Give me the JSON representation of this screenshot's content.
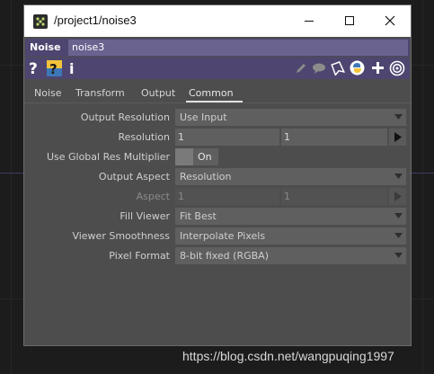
{
  "window": {
    "title": "/project1/noise3"
  },
  "operator": {
    "type_label": "Noise",
    "name": "noise3"
  },
  "iconbar": {
    "left_icons": [
      "help-icon",
      "python-help-icon",
      "info-icon"
    ],
    "right_icons": [
      "pencil-icon",
      "comment-icon",
      "bookmark-icon",
      "python-icon",
      "add-icon",
      "target-icon"
    ]
  },
  "tabs": [
    {
      "label": "Noise",
      "active": false
    },
    {
      "label": "Transform",
      "active": false
    },
    {
      "label": "Output",
      "active": false
    },
    {
      "label": "Common",
      "active": true
    }
  ],
  "params": {
    "output_resolution": {
      "label": "Output Resolution",
      "value": "Use Input"
    },
    "resolution": {
      "label": "Resolution",
      "value1": "1",
      "value2": "1"
    },
    "use_global_res": {
      "label": "Use Global Res Multiplier",
      "value": "On"
    },
    "output_aspect": {
      "label": "Output Aspect",
      "value": "Resolution"
    },
    "aspect": {
      "label": "Aspect",
      "value1": "1",
      "value2": "1"
    },
    "fill_viewer": {
      "label": "Fill Viewer",
      "value": "Fit Best"
    },
    "viewer_smoothness": {
      "label": "Viewer Smoothness",
      "value": "Interpolate Pixels"
    },
    "pixel_format": {
      "label": "Pixel Format",
      "value": "8-bit fixed (RGBA)"
    }
  },
  "watermark": "https://blog.csdn.net/wangpuqing1997"
}
